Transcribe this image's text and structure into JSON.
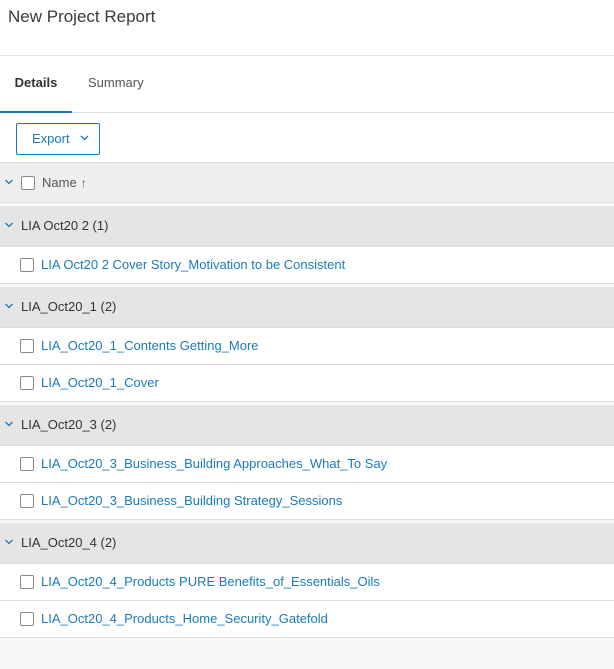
{
  "page": {
    "title": "New Project Report"
  },
  "tabs": [
    {
      "label": "Details",
      "active": true
    },
    {
      "label": "Summary",
      "active": false
    }
  ],
  "toolbar": {
    "export_label": "Export",
    "export_icon": "chevron-down-icon"
  },
  "table": {
    "column_header": "Name",
    "sort_indicator": "↑",
    "groups": [
      {
        "label": "LIA Oct20 2 (1)",
        "items": [
          "LIA Oct20 2 Cover Story_Motivation to be Consistent"
        ]
      },
      {
        "label": "LIA_Oct20_1 (2)",
        "items": [
          "LIA_Oct20_1_Contents Getting_More",
          "LIA_Oct20_1_Cover"
        ]
      },
      {
        "label": "LIA_Oct20_3 (2)",
        "items": [
          "LIA_Oct20_3_Business_Building Approaches_What_To Say",
          "LIA_Oct20_3_Business_Building Strategy_Sessions"
        ]
      },
      {
        "label": "LIA_Oct20_4 (2)",
        "items": [
          "LIA_Oct20_4_Products PURE Benefits_of_Essentials_Oils",
          "LIA_Oct20_4_Products_Home_Security_Gatefold"
        ]
      }
    ]
  },
  "colors": {
    "accent": "#1a7bb8",
    "group_bg": "#e5e5e5",
    "header_bg": "#efefef",
    "page_bg": "#f7f7f7"
  }
}
